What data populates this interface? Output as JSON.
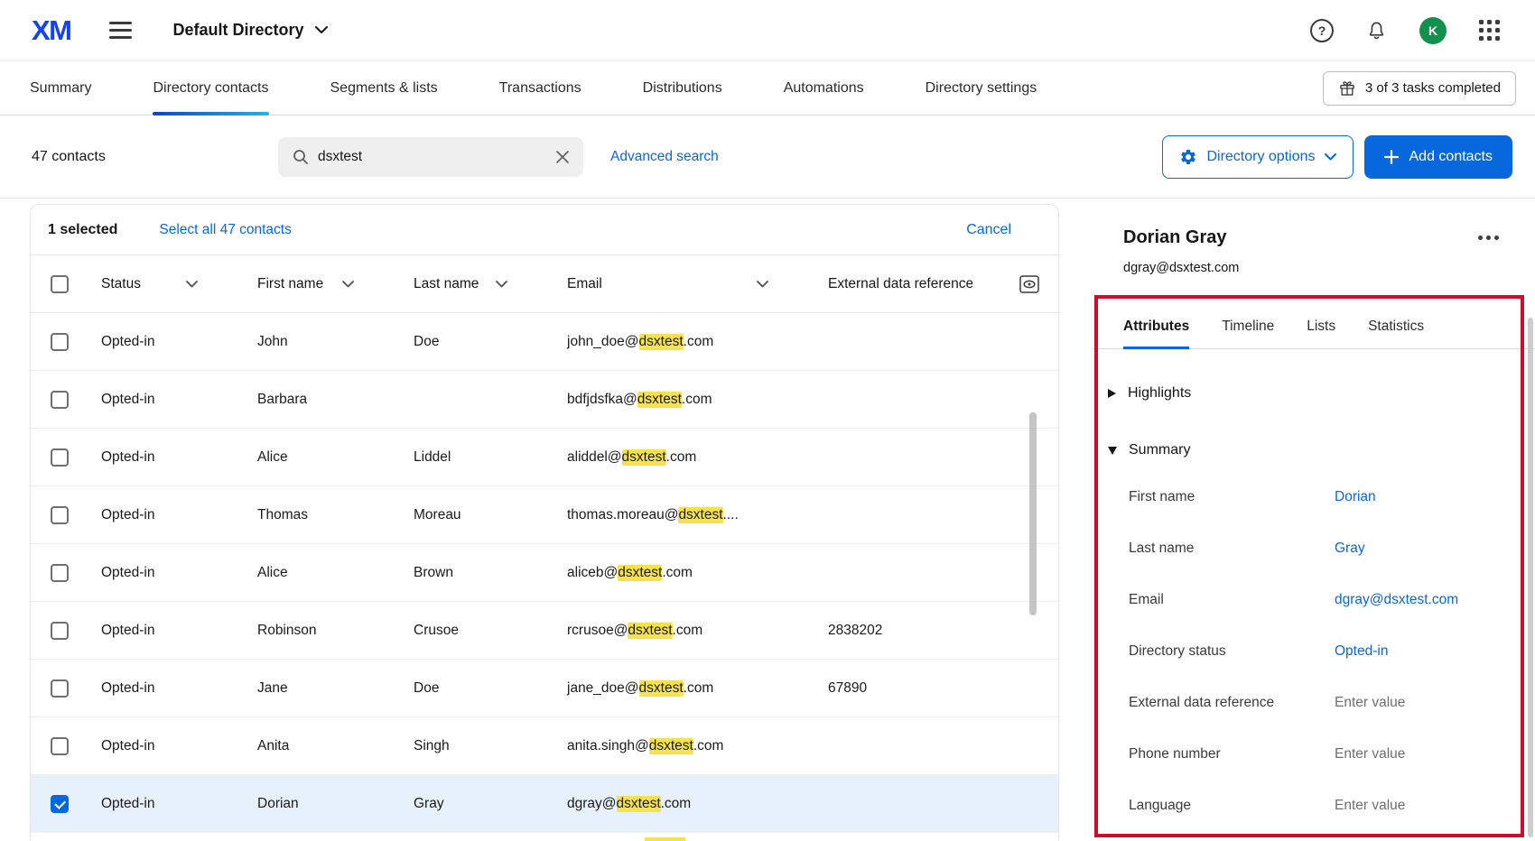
{
  "header": {
    "logo": "XM",
    "directory_name": "Default Directory",
    "help_label": "?",
    "avatar_initial": "K"
  },
  "nav": {
    "tabs": [
      {
        "label": "Summary"
      },
      {
        "label": "Directory contacts"
      },
      {
        "label": "Segments & lists"
      },
      {
        "label": "Transactions"
      },
      {
        "label": "Distributions"
      },
      {
        "label": "Automations"
      },
      {
        "label": "Directory settings"
      }
    ],
    "active_tab": "Directory contacts",
    "tasks_label": "3 of 3 tasks completed"
  },
  "toolbar": {
    "count_label": "47 contacts",
    "search_value": "dsxtest",
    "advanced_search_label": "Advanced search",
    "directory_options_label": "Directory options",
    "add_contacts_label": "Add contacts"
  },
  "selection_bar": {
    "selected_label": "1 selected",
    "select_all_label": "Select all 47 contacts",
    "cancel_label": "Cancel"
  },
  "table": {
    "columns": {
      "status": "Status",
      "first_name": "First name",
      "last_name": "Last name",
      "email": "Email",
      "external": "External data reference"
    },
    "search_highlight": "dsxtest",
    "rows": [
      {
        "status": "Opted-in",
        "first": "John",
        "last": "Doe",
        "email_pre": "john_doe@",
        "email_hl": "dsxtest",
        "email_post": ".com",
        "ext": "",
        "selected": false
      },
      {
        "status": "Opted-in",
        "first": "Barbara",
        "last": "",
        "email_pre": "bdfjdsfka@",
        "email_hl": "dsxtest",
        "email_post": ".com",
        "ext": "",
        "selected": false
      },
      {
        "status": "Opted-in",
        "first": "Alice",
        "last": "Liddel",
        "email_pre": "aliddel@",
        "email_hl": "dsxtest",
        "email_post": ".com",
        "ext": "",
        "selected": false
      },
      {
        "status": "Opted-in",
        "first": "Thomas",
        "last": "Moreau",
        "email_pre": "thomas.moreau@",
        "email_hl": "dsxtest",
        "email_post": "....",
        "ext": "",
        "selected": false
      },
      {
        "status": "Opted-in",
        "first": "Alice",
        "last": "Brown",
        "email_pre": "aliceb@",
        "email_hl": "dsxtest",
        "email_post": ".com",
        "ext": "",
        "selected": false
      },
      {
        "status": "Opted-in",
        "first": "Robinson",
        "last": "Crusoe",
        "email_pre": "rcrusoe@",
        "email_hl": "dsxtest",
        "email_post": ".com",
        "ext": "2838202",
        "selected": false
      },
      {
        "status": "Opted-in",
        "first": "Jane",
        "last": "Doe",
        "email_pre": "jane_doe@",
        "email_hl": "dsxtest",
        "email_post": ".com",
        "ext": "67890",
        "selected": false
      },
      {
        "status": "Opted-in",
        "first": "Anita",
        "last": "Singh",
        "email_pre": "anita.singh@",
        "email_hl": "dsxtest",
        "email_post": ".com",
        "ext": "",
        "selected": false
      },
      {
        "status": "Opted-in",
        "first": "Dorian",
        "last": "Gray",
        "email_pre": "dgray@",
        "email_hl": "dsxtest",
        "email_post": ".com",
        "ext": "",
        "selected": true
      }
    ]
  },
  "panel": {
    "title": "Dorian Gray",
    "subtitle": "dgray@dsxtest.com",
    "tabs": [
      "Attributes",
      "Timeline",
      "Lists",
      "Statistics"
    ],
    "active_tab": "Attributes",
    "sections": {
      "highlights": "Highlights",
      "summary": "Summary"
    },
    "fields": [
      {
        "label": "First name",
        "value": "Dorian",
        "is_set": true
      },
      {
        "label": "Last name",
        "value": "Gray",
        "is_set": true
      },
      {
        "label": "Email",
        "value": "dgray@dsxtest.com",
        "is_set": true
      },
      {
        "label": "Directory status",
        "value": "Opted-in",
        "is_set": true
      },
      {
        "label": "External data reference",
        "value": "Enter value",
        "is_set": false
      },
      {
        "label": "Phone number",
        "value": "Enter value",
        "is_set": false
      },
      {
        "label": "Language",
        "value": "Enter value",
        "is_set": false
      }
    ]
  },
  "colors": {
    "accent_blue": "#0768DD",
    "highlight_yellow": "#F6E34B",
    "selected_row_blue": "#E7F1FC",
    "annotation_red": "#C8102E",
    "avatar_green": "#12914C",
    "nav_underline_gradient_start": "#0D47C4",
    "nav_underline_gradient_end": "#21B3E8"
  }
}
